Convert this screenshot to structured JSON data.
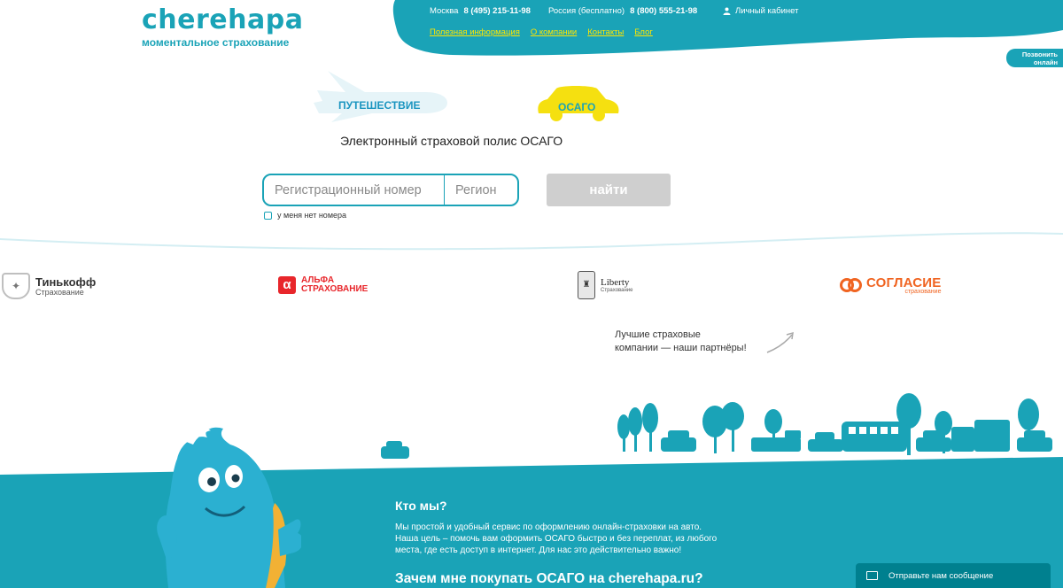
{
  "header": {
    "logo_title": "cherehapa",
    "logo_subtitle": "моментальное страхование",
    "phone_moscow_label": "Москва",
    "phone_moscow": "8 (495) 215-11-98",
    "phone_russia_label": "Россия (бесплатно)",
    "phone_russia": "8 (800) 555-21-98",
    "cabinet": "Личный кабинет",
    "nav": [
      "Полезная информация",
      "О компании",
      "Контакты",
      "Блог"
    ],
    "callback": "Позвонить онлайн"
  },
  "products": {
    "travel": "ПУТЕШЕСТВИЕ",
    "osago": "ОСАГО"
  },
  "page_title": "Электронный страховой полис ОСАГО",
  "search": {
    "reg_placeholder": "Регистрационный номер",
    "region_placeholder": "Регион",
    "button": "найти",
    "no_number_label": "у меня нет номера"
  },
  "partners": {
    "tinkoff_name": "Тинькофф",
    "tinkoff_sub": "Страхование",
    "alfa_line1": "АЛЬФА",
    "alfa_line2": "СТРАХОВАНИЕ",
    "liberty_name": "Liberty",
    "liberty_sub": "Страхование",
    "soglasie_name": "СОГЛАСИЕ",
    "soglasie_sub": "страхование",
    "note_line1": "Лучшие страховые",
    "note_line2": "компании — наши партнёры!"
  },
  "about": {
    "title": "Кто мы?",
    "line1": "Мы простой и удобный сервис по оформлению онлайн-страховки на авто.",
    "line2": "Наша цель – помочь вам оформить ОСАГО быстро и без переплат, из любого",
    "line3": "места, где есть доступ в интернет. Для нас это действительно важно!",
    "why_title": "Зачем мне покупать ОСАГО на cherehapa.ru?"
  },
  "chat": {
    "label": "Отправьте нам сообщение"
  },
  "colors": {
    "brand": "#1aa3b7",
    "nav_link": "#ffe600",
    "osago_car": "#f5e010",
    "alfa": "#e8262b",
    "soglasie": "#f06421",
    "button_disabled": "#cfcfcf"
  }
}
